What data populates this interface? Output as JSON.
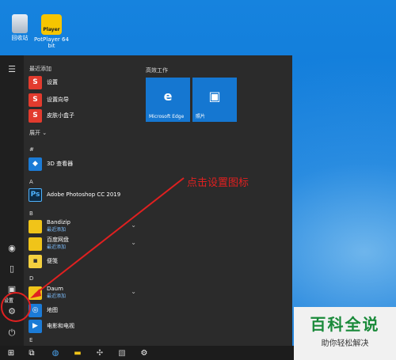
{
  "desktop": {
    "icons": [
      {
        "label": "回收站"
      },
      {
        "label": "PotPlayer 64 bit",
        "badge": "Player"
      }
    ]
  },
  "start_menu": {
    "recent_header": "最近添加",
    "recent_apps": [
      {
        "label": "设置",
        "icon": "sougou-icon"
      },
      {
        "label": "设置向导",
        "icon": "sougou-icon"
      },
      {
        "label": "皮肤小盒子",
        "icon": "sougou-icon"
      }
    ],
    "expand_label": "展开",
    "sections": [
      {
        "letter": "#",
        "apps": [
          {
            "label": "3D 查看器"
          }
        ]
      },
      {
        "letter": "A",
        "apps": [
          {
            "label": "Adobe Photoshop CC 2019"
          }
        ]
      },
      {
        "letter": "B",
        "apps": [
          {
            "label": "Bandizip",
            "sub": "最近添加",
            "chevron": true
          },
          {
            "label": "百度网盘",
            "sub": "最近添加",
            "chevron": true
          },
          {
            "label": "便笺"
          }
        ]
      },
      {
        "letter": "D",
        "apps": [
          {
            "label": "Daum",
            "sub": "最近添加",
            "chevron": true
          },
          {
            "label": "地图"
          },
          {
            "label": "电影和电视"
          }
        ]
      },
      {
        "letter": "E",
        "apps": []
      }
    ],
    "tiles_header": "高效工作",
    "tiles": [
      {
        "label": "Microsoft Edge",
        "glyph": "e"
      },
      {
        "label": "照片",
        "glyph": "▣"
      }
    ],
    "settings_tooltip": "设置"
  },
  "annotation": {
    "text": "点击设置图标"
  },
  "watermark": {
    "title": "百科全说",
    "subtitle": "助你轻松解决"
  },
  "colors": {
    "accent": "#1577d1",
    "annotation": "#e02020",
    "menu_bg": "#2b2b2b"
  }
}
